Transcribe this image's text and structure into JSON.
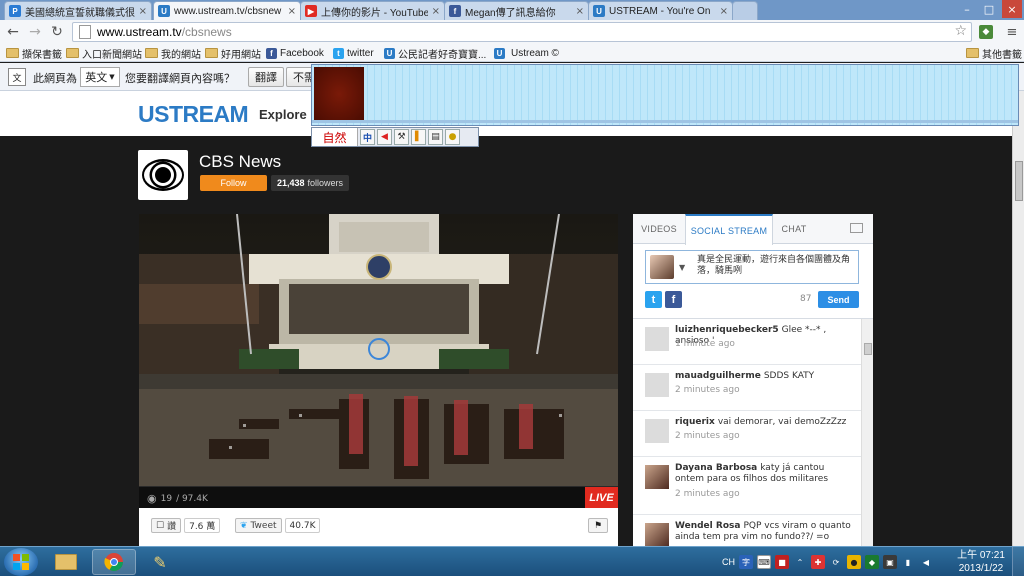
{
  "browser": {
    "tabs": [
      {
        "label": "美國總統宣誓就職儀式很",
        "favicon": "P",
        "color": "#2a7bd4"
      },
      {
        "label": "www.ustream.tv/cbsnew",
        "favicon": "U",
        "color": "#2c7bc5"
      },
      {
        "label": "上傳你的影片 - YouTube",
        "favicon": "▶",
        "color": "#e02b24"
      },
      {
        "label": "Megan傳了訊息給你",
        "favicon": "f",
        "color": "#3b5998"
      },
      {
        "label": "USTREAM - You're On",
        "favicon": "U",
        "color": "#2c7bc5"
      }
    ],
    "url_host": "www.ustream.tv",
    "url_path": "/cbsnews",
    "bookmarks": [
      {
        "label": "擷保書籤",
        "type": "folder"
      },
      {
        "label": "入口新聞網站",
        "type": "folder"
      },
      {
        "label": "我的網站",
        "type": "folder"
      },
      {
        "label": "好用網站",
        "type": "folder"
      },
      {
        "label": "Facebook",
        "type": "facebook"
      },
      {
        "label": "twitter",
        "type": "twitter"
      },
      {
        "label": "公民記者好奇寶寶...",
        "type": "ustream"
      },
      {
        "label": "",
        "type": "ustream"
      },
      {
        "label": "Ustream ©",
        "type": "ustream"
      }
    ],
    "other_bookmarks": "其他書籤"
  },
  "translate_bar": {
    "label": "此網頁為",
    "language": "英文",
    "question": "您要翻譯網頁內容嗎？",
    "translate_button": "翻譯",
    "never_button": "不需"
  },
  "ime": {
    "logo": "自然",
    "mode": "中"
  },
  "ustream": {
    "logo": "USTREAM",
    "nav_explore": "Explore",
    "channel_name": "CBS News",
    "follow_label": "Follow",
    "followers_count": "21,438",
    "followers_label": "followers",
    "viewers_now": "19",
    "viewers_total": "/ 97.4K",
    "live_label": "LIVE",
    "like_label": "讚",
    "like_count": "7.6 萬",
    "tweet_label": "Tweet",
    "tweet_count": "40.7K"
  },
  "side_panel": {
    "tabs": [
      "VIDEOS",
      "SOCIAL STREAM",
      "CHAT"
    ],
    "active_tab": "SOCIAL STREAM",
    "compose_text": "真是全民運動，遊行來自各個團體及角落，騎馬咧",
    "char_count": "87",
    "send_label": "Send",
    "feed": [
      {
        "user": "luizhenriquebecker5",
        "message": "Glee *--* , ansioso '",
        "time": "1 minute ago",
        "avatar": "blank"
      },
      {
        "user": "mauadguilherme",
        "message": "SDDS KATY",
        "time": "2 minutes ago",
        "avatar": "blank"
      },
      {
        "user": "riquerix",
        "message": "vai demorar, vai demoZzZzz",
        "time": "2 minutes ago",
        "avatar": "blank"
      },
      {
        "user": "Dayana Barbosa",
        "message": "katy já cantou ontem para os filhos dos militares",
        "time": "2 minutes ago",
        "avatar": "pic"
      },
      {
        "user": "Wendel Rosa",
        "message": "PQP vcs viram o quanto ainda tem pra vim no fundo??/ =o",
        "time": "",
        "avatar": "pic"
      }
    ]
  },
  "taskbar": {
    "lang": "CH",
    "time": "上午 07:21",
    "date": "2013/1/22"
  },
  "colors": {
    "ustream_blue": "#2c7bc5",
    "follow_orange": "#f08a1c",
    "live_red": "#e12a1f",
    "send_blue": "#2c8ee5"
  }
}
